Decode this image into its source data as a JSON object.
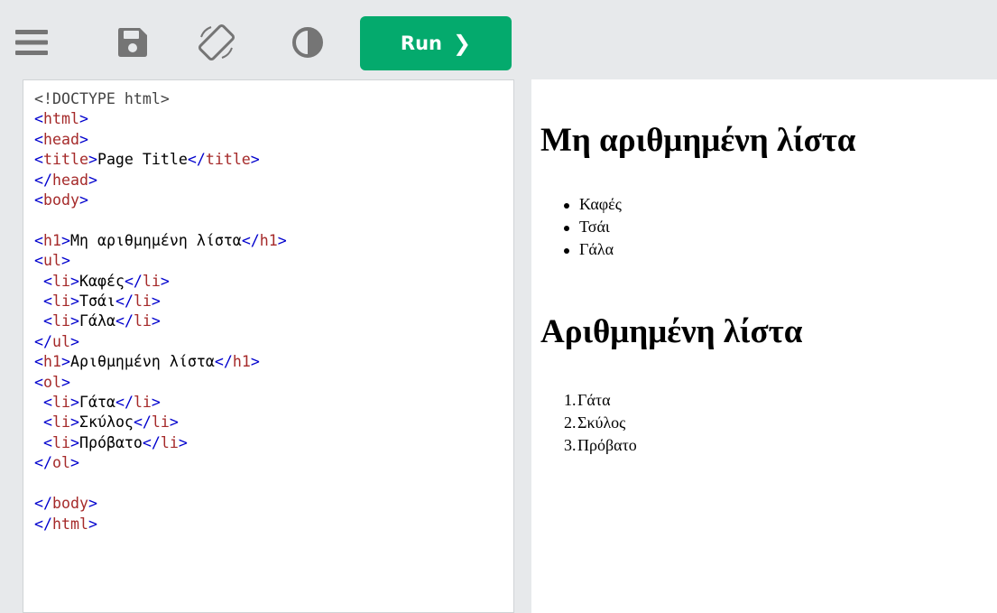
{
  "toolbar": {
    "icons": [
      "menu-icon",
      "save-icon",
      "rotate-icon",
      "contrast-icon"
    ],
    "run_label": "Run",
    "run_chevron": "❯",
    "colors": {
      "run_bg": "#04aa6d",
      "icon": "#757575",
      "toolbar_bg": "#e7e9eb"
    }
  },
  "editor": {
    "lines": [
      "<!DOCTYPE html>",
      "<html>",
      "<head>",
      "<title>Page Title</title>",
      "</head>",
      "<body>",
      "",
      "<h1>Μη αριθμημένη λίστα</h1>",
      "<ul>",
      " <li>Καφές</li>",
      " <li>Τσάι</li>",
      " <li>Γάλα</li>",
      "</ul>",
      "<h1>Αριθμημένη λίστα</h1>",
      "<ol>",
      " <li>Γάτα</li>",
      " <li>Σκύλος</li>",
      " <li>Πρόβατο</li>",
      "</ol>",
      "",
      "</body>",
      "</html>"
    ]
  },
  "result": {
    "heading_unordered": "Μη αριθμημένη λίστα",
    "unordered_items": [
      "Καφές",
      "Τσάι",
      "Γάλα"
    ],
    "heading_ordered": "Αριθμημένη λίστα",
    "ordered_items": [
      "Γάτα",
      "Σκύλος",
      "Πρόβατο"
    ]
  }
}
